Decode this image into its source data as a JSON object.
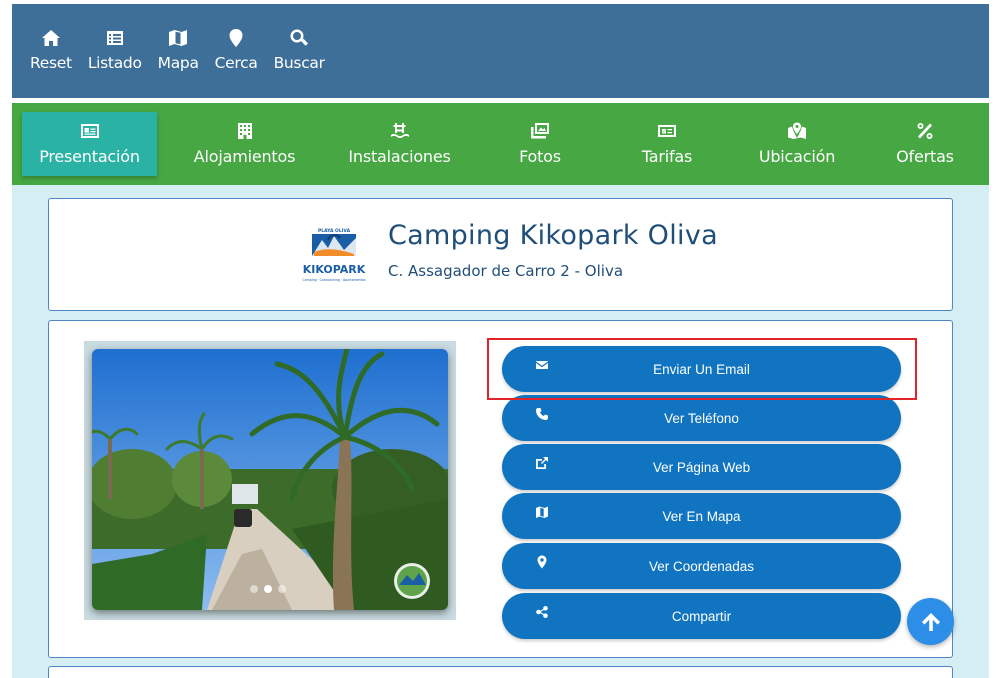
{
  "top_nav": {
    "items": [
      {
        "label": "Reset",
        "icon": "home-icon"
      },
      {
        "label": "Listado",
        "icon": "list-icon"
      },
      {
        "label": "Mapa",
        "icon": "map-icon"
      },
      {
        "label": "Cerca",
        "icon": "location-pin-icon"
      },
      {
        "label": "Buscar",
        "icon": "search-icon"
      }
    ]
  },
  "tabs": [
    {
      "label": "Presentación",
      "icon": "id-card-icon",
      "active": true
    },
    {
      "label": "Alojamientos",
      "icon": "building-icon",
      "active": false
    },
    {
      "label": "Instalaciones",
      "icon": "pool-icon",
      "active": false
    },
    {
      "label": "Fotos",
      "icon": "photos-icon",
      "active": false
    },
    {
      "label": "Tarifas",
      "icon": "money-icon",
      "active": false
    },
    {
      "label": "Ubicación",
      "icon": "map-marker-icon",
      "active": false
    },
    {
      "label": "Ofertas",
      "icon": "percent-icon",
      "active": false
    }
  ],
  "camping": {
    "name": "Camping Kikopark Oliva",
    "address": "C. Assagador de Carro 2 - Oliva",
    "logo": {
      "top_text": "PLAYA OLIVA",
      "brand": "KIKOPARK",
      "tagline": "Camping · Caravanning · Apartamentos"
    }
  },
  "actions": [
    {
      "label": "Enviar Un Email",
      "icon": "envelope-icon"
    },
    {
      "label": "Ver Teléfono",
      "icon": "phone-icon"
    },
    {
      "label": "Ver Página Web",
      "icon": "external-link-icon"
    },
    {
      "label": "Ver En Mapa",
      "icon": "map-icon"
    },
    {
      "label": "Ver Coordenadas",
      "icon": "location-pin-icon"
    },
    {
      "label": "Compartir",
      "icon": "share-icon"
    }
  ],
  "colors": {
    "top_nav_bg": "#3e6f98",
    "tab_bar_bg": "#46a743",
    "tab_active_bg": "#2ab3a4",
    "button_bg": "#1074c1",
    "highlight": "#e0242a"
  }
}
